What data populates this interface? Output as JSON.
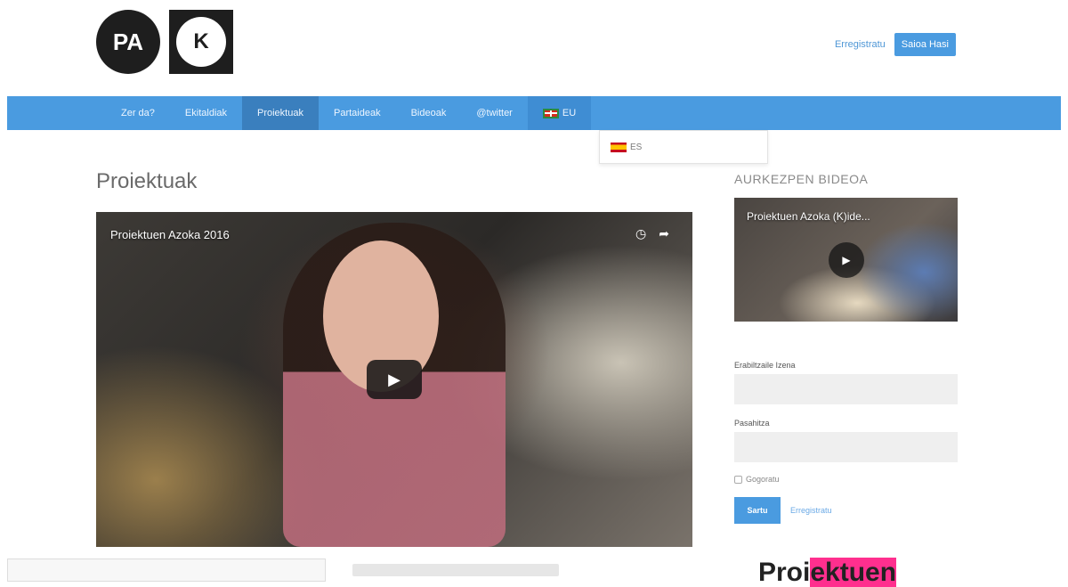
{
  "logo": {
    "pa": "PA",
    "k": "K"
  },
  "header": {
    "register_link": "Erregistratu",
    "login_button": "Saioa Hasi"
  },
  "nav": {
    "items": [
      "Zer da?",
      "Ekitaldiak",
      "Proiektuak",
      "Partaideak",
      "Bideoak",
      "@twitter"
    ],
    "active": "Proiektuak",
    "lang_current": "EU"
  },
  "lang_dropdown": {
    "option": "ES"
  },
  "colors": {
    "brand": "#4a9be0",
    "active_nav": "#3a7fbe",
    "logo": "#1e1e1e"
  },
  "main": {
    "title": "Proiektuak",
    "video": {
      "title": "Proiektuen Azoka 2016"
    }
  },
  "sidebar": {
    "title": "AURKEZPEN BIDEOA",
    "thumb_title": "Proiektuen Azoka (K)ide...",
    "username_label": "Erabiltzaile Izena",
    "password_label": "Pasahitza",
    "remember_label": "Gogoratu",
    "submit_label": "Sartu",
    "register_link": "Erregistratu"
  },
  "bottom": {
    "banner_left": "Proi",
    "banner_hl": "ektuen"
  }
}
